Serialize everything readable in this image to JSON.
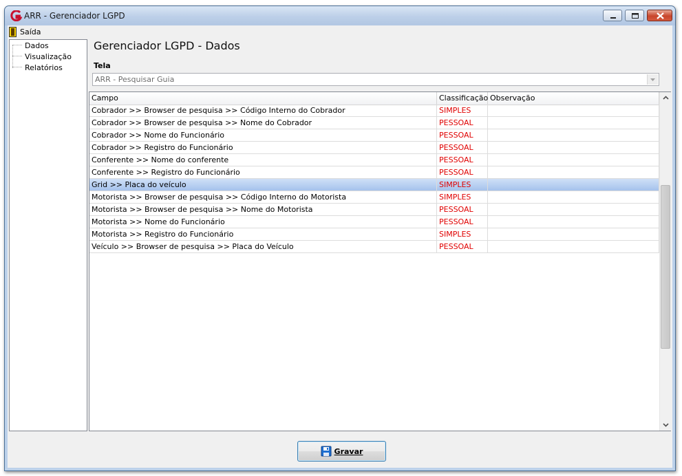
{
  "window": {
    "title": "ARR - Gerenciador LGPD"
  },
  "menu": {
    "items": [
      {
        "label": "Saída"
      }
    ]
  },
  "tree": {
    "items": [
      {
        "label": "Dados"
      },
      {
        "label": "Visualização"
      },
      {
        "label": "Relatórios"
      }
    ]
  },
  "page": {
    "title": "Gerenciador LGPD - Dados"
  },
  "tela": {
    "label": "Tela",
    "value": "ARR - Pesquisar Guia"
  },
  "grid": {
    "columns": [
      "Campo",
      "Classificação",
      "Observação"
    ],
    "rows": [
      {
        "campo": "Cobrador >> Browser de pesquisa >> Código Interno do Cobrador",
        "classificacao": "SIMPLES",
        "observacao": ""
      },
      {
        "campo": "Cobrador >> Browser de pesquisa >> Nome do Cobrador",
        "classificacao": "PESSOAL",
        "observacao": ""
      },
      {
        "campo": "Cobrador >> Nome do Funcionário",
        "classificacao": "PESSOAL",
        "observacao": ""
      },
      {
        "campo": "Cobrador >> Registro do Funcionário",
        "classificacao": "PESSOAL",
        "observacao": ""
      },
      {
        "campo": "Conferente >> Nome do conferente",
        "classificacao": "PESSOAL",
        "observacao": ""
      },
      {
        "campo": "Conferente >> Registro do Funcionário",
        "classificacao": "PESSOAL",
        "observacao": ""
      },
      {
        "campo": "Grid >> Placa do veículo",
        "classificacao": "SIMPLES",
        "observacao": ""
      },
      {
        "campo": "Motorista >> Browser de pesquisa >> Código Interno do Motorista",
        "classificacao": "SIMPLES",
        "observacao": ""
      },
      {
        "campo": "Motorista >> Browser de pesquisa >> Nome do Motorista",
        "classificacao": "PESSOAL",
        "observacao": ""
      },
      {
        "campo": "Motorista >> Nome do Funcionário",
        "classificacao": "PESSOAL",
        "observacao": ""
      },
      {
        "campo": "Motorista >> Registro do Funcionário",
        "classificacao": "SIMPLES",
        "observacao": ""
      },
      {
        "campo": "Veículo >> Browser de pesquisa >> Placa do Veículo",
        "classificacao": "PESSOAL",
        "observacao": ""
      }
    ]
  },
  "buttons": {
    "save_label": "Gravar"
  },
  "colors": {
    "classification": "#e00000",
    "selected_row": "#a5c2ec"
  },
  "icons": {
    "app": "app-logo-icon",
    "exit": "exit-door-icon",
    "save": "floppy-disk-icon"
  }
}
